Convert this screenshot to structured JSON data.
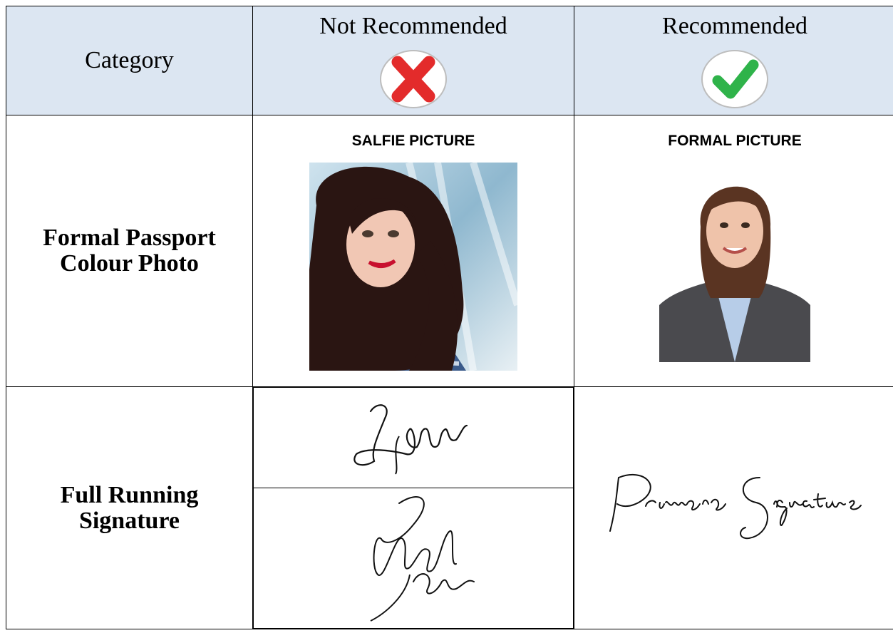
{
  "header": {
    "category": "Category",
    "not_recommended": "Not Recommended",
    "recommended": "Recommended",
    "not_recommended_mark": "red-x-icon",
    "recommended_mark": "green-check-icon"
  },
  "rows": [
    {
      "label": "Formal Passport Colour Photo",
      "label_line1": "Formal Passport",
      "label_line2": "Colour Photo",
      "not_recommended_caption": "SALFIE PICTURE",
      "recommended_caption": "FORMAL PICTURE"
    },
    {
      "label": "Full Running Signature",
      "label_line1": "Full Running",
      "label_line2": "Signature",
      "recommended_signature_text": "Primera Signature"
    }
  ],
  "colors": {
    "header_bg": "#dce6f2",
    "x_red": "#e32b2b",
    "check_green": "#2fb34a"
  }
}
